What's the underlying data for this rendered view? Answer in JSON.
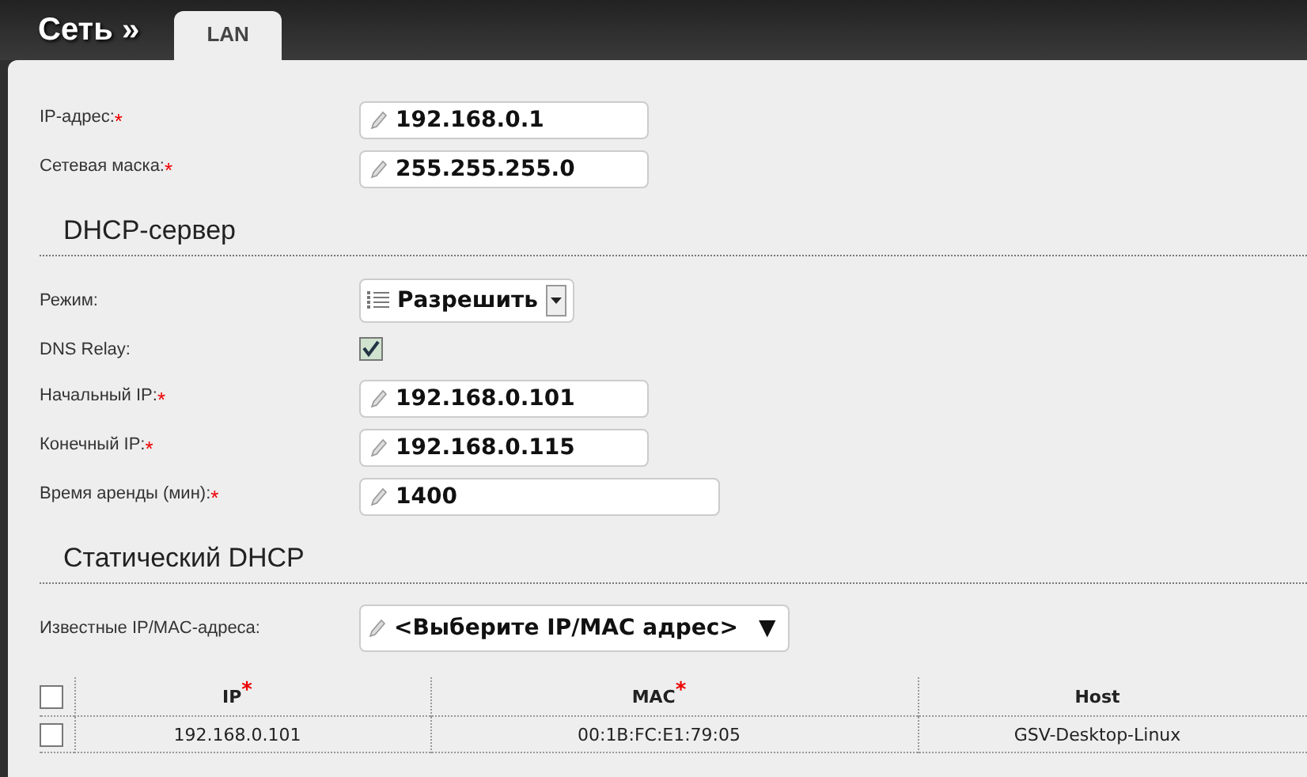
{
  "header": {
    "title": "Сеть »",
    "tabs": [
      {
        "label": "LAN",
        "selected": true
      }
    ]
  },
  "fields": [
    {
      "label": "IP-адрес:",
      "mark": "*",
      "kind": "text",
      "value": "192.168.0.1",
      "wide": false
    },
    {
      "label": "Сетевая маска:",
      "mark": "*",
      "kind": "text",
      "value": "255.255.255.0",
      "wide": false
    }
  ],
  "sections": [
    {
      "title": "DHCP-сервер",
      "fields": [
        {
          "label": "Режим:",
          "kind": "select",
          "value": "Разрешить"
        },
        {
          "label": "DNS Relay:",
          "kind": "checkbox",
          "checked": true
        },
        {
          "label": "Начальный IP:",
          "mark": "*",
          "kind": "text",
          "value": "192.168.0.101",
          "wide": false
        },
        {
          "label": "Конечный IP:",
          "mark": "*",
          "kind": "text",
          "value": "192.168.0.115",
          "wide": false
        },
        {
          "label": "Время аренды (мин):",
          "mark": "*",
          "kind": "text",
          "value": "1400",
          "wide": true
        }
      ]
    },
    {
      "title": "Статический DHCP",
      "fields": [
        {
          "label": "Известные IP/MAC-адреса:",
          "kind": "combo",
          "value": "<Выберите IP/MAC адрес>",
          "caret": "▼"
        }
      ]
    }
  ],
  "table": {
    "all_checked": false,
    "columns": [
      {
        "label": "IP",
        "mark": "*"
      },
      {
        "label": "MAC",
        "mark": "*"
      },
      {
        "label": "Host"
      }
    ],
    "rows": [
      {
        "checked": false,
        "cells": [
          "192.168.0.101",
          "00:1B:FC:E1:79:05",
          "GSV-Desktop-Linux"
        ]
      }
    ]
  }
}
